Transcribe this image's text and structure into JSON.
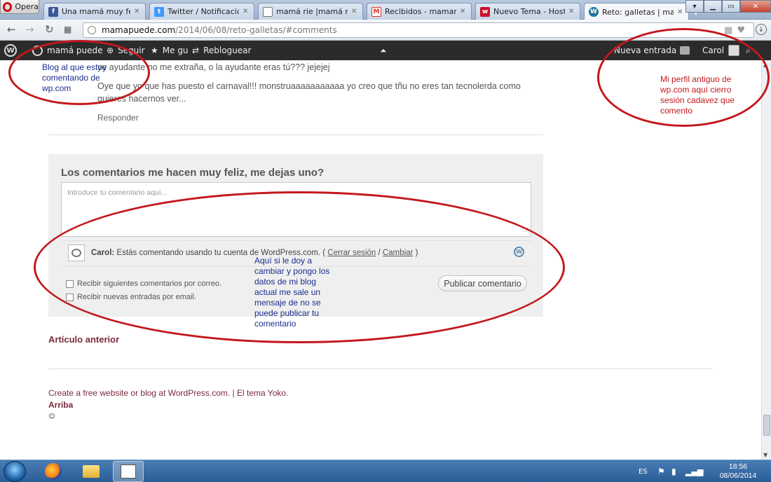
{
  "browser": {
    "menu_label": "Opera",
    "tabs": [
      {
        "label": "Una mamá muy feliz",
        "icon": "facebook-icon",
        "color": "#3b5998"
      },
      {
        "label": "Twitter / Notificaciones",
        "icon": "twitter-icon",
        "color": "#4099ff"
      },
      {
        "label": "mamá rie |mamá rie",
        "icon": "avatar-icon",
        "color": "#777777"
      },
      {
        "label": "Recibidos - mamarrei",
        "icon": "gmail-icon",
        "color": "#d93025"
      },
      {
        "label": "Nuevo Tema - Hosting",
        "icon": "hosting-icon",
        "color": "#c8102e"
      },
      {
        "label": "Reto: galletas | mamá p",
        "icon": "wordpress-icon",
        "color": "#21759b"
      }
    ],
    "new_tab": "+",
    "url_host": "mamapuede.com",
    "url_path": "/2014/06/08/reto-galletas/#comments"
  },
  "adminbar": {
    "site": "mamá puede",
    "follow": "Seguir",
    "like": "Me gu",
    "reblog": "Rebloguear",
    "new_post": "Nueva entrada",
    "user": "Carol"
  },
  "comment": {
    "line1": "ye ayudante no me extraña, o la ayudante eras tú??? jejejej",
    "line2": "Oye que yo que has puesto el carnaval!!! monstruaaaaaaaaaaa yo creo que tñu no eres tan tecnolerda como",
    "line3": "quieres hacernos ver...",
    "reply": "Responder"
  },
  "comment_form": {
    "title": "Los comentarios me hacen muy feliz, me dejas uno?",
    "placeholder": "Introduce tu comentario aquí...",
    "identity_user": "Carol:",
    "identity_text": " Estás comentando usando tu cuenta de WordPress.com. ( ",
    "logout": "Cerrar sesión",
    "sep": " / ",
    "change": "Cambiar",
    "close_paren": " )",
    "check_comments": "Recibir siguientes comentarios por correo.",
    "check_posts": "Recibir nuevas entradas por email.",
    "submit": "Publicar comentario"
  },
  "footer": {
    "prev": "Artículo anterior",
    "credit": "Create a free website or blog at WordPress.com. | El tema Yoko.",
    "top": "Arriba"
  },
  "annotations": {
    "blog_note": [
      "Blog al que estoy",
      "comentando de",
      "wp.com"
    ],
    "profile_note": [
      "Mi perfil antiguo de",
      "wp.com aquí cierro",
      "sesión cadavez que",
      "comento"
    ],
    "change_note": [
      "Aquí si le doy a",
      "cambiar y pongo los",
      "datos de mi blog",
      "actual me sale un",
      "mensaje de no se",
      "puede publicar tu",
      "comentario"
    ],
    "ellipse_color": "#c3181d"
  },
  "taskbar": {
    "lang": "ES",
    "time": "18:56",
    "date": "08/06/2014"
  }
}
